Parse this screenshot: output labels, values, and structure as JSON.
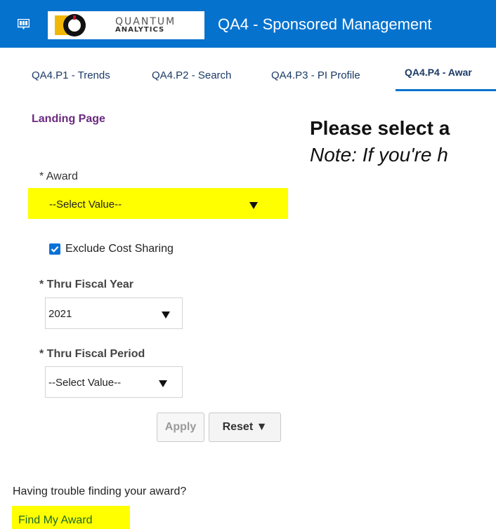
{
  "header": {
    "title": "QA4 - Sponsored Management",
    "logo": {
      "line1": "QUANTUM",
      "line2": "ANALYTICS"
    },
    "bar_color": "#0572ce"
  },
  "tabs": [
    {
      "label": "QA4.P1 - Trends"
    },
    {
      "label": "QA4.P2 - Search"
    },
    {
      "label": "QA4.P3 - PI Profile"
    },
    {
      "label": "QA4.P4 - Awar",
      "active": true
    }
  ],
  "sidebar": {
    "landing_label": "Landing Page",
    "award": {
      "label": "* Award",
      "value": "--Select Value--"
    },
    "exclude_cost_sharing": {
      "label": "Exclude Cost Sharing",
      "checked": true
    },
    "fiscal_year": {
      "label": "* Thru Fiscal Year",
      "value": "2021"
    },
    "fiscal_period": {
      "label": "* Thru Fiscal Period",
      "value": "--Select Value--"
    },
    "apply_label": "Apply",
    "reset_label": "Reset ▼",
    "trouble_text": "Having trouble finding your award?",
    "find_link": "Find My Award",
    "highlight_color": "#ffff00"
  },
  "main": {
    "heading": "Please select a",
    "note": "Note: If you're h"
  }
}
